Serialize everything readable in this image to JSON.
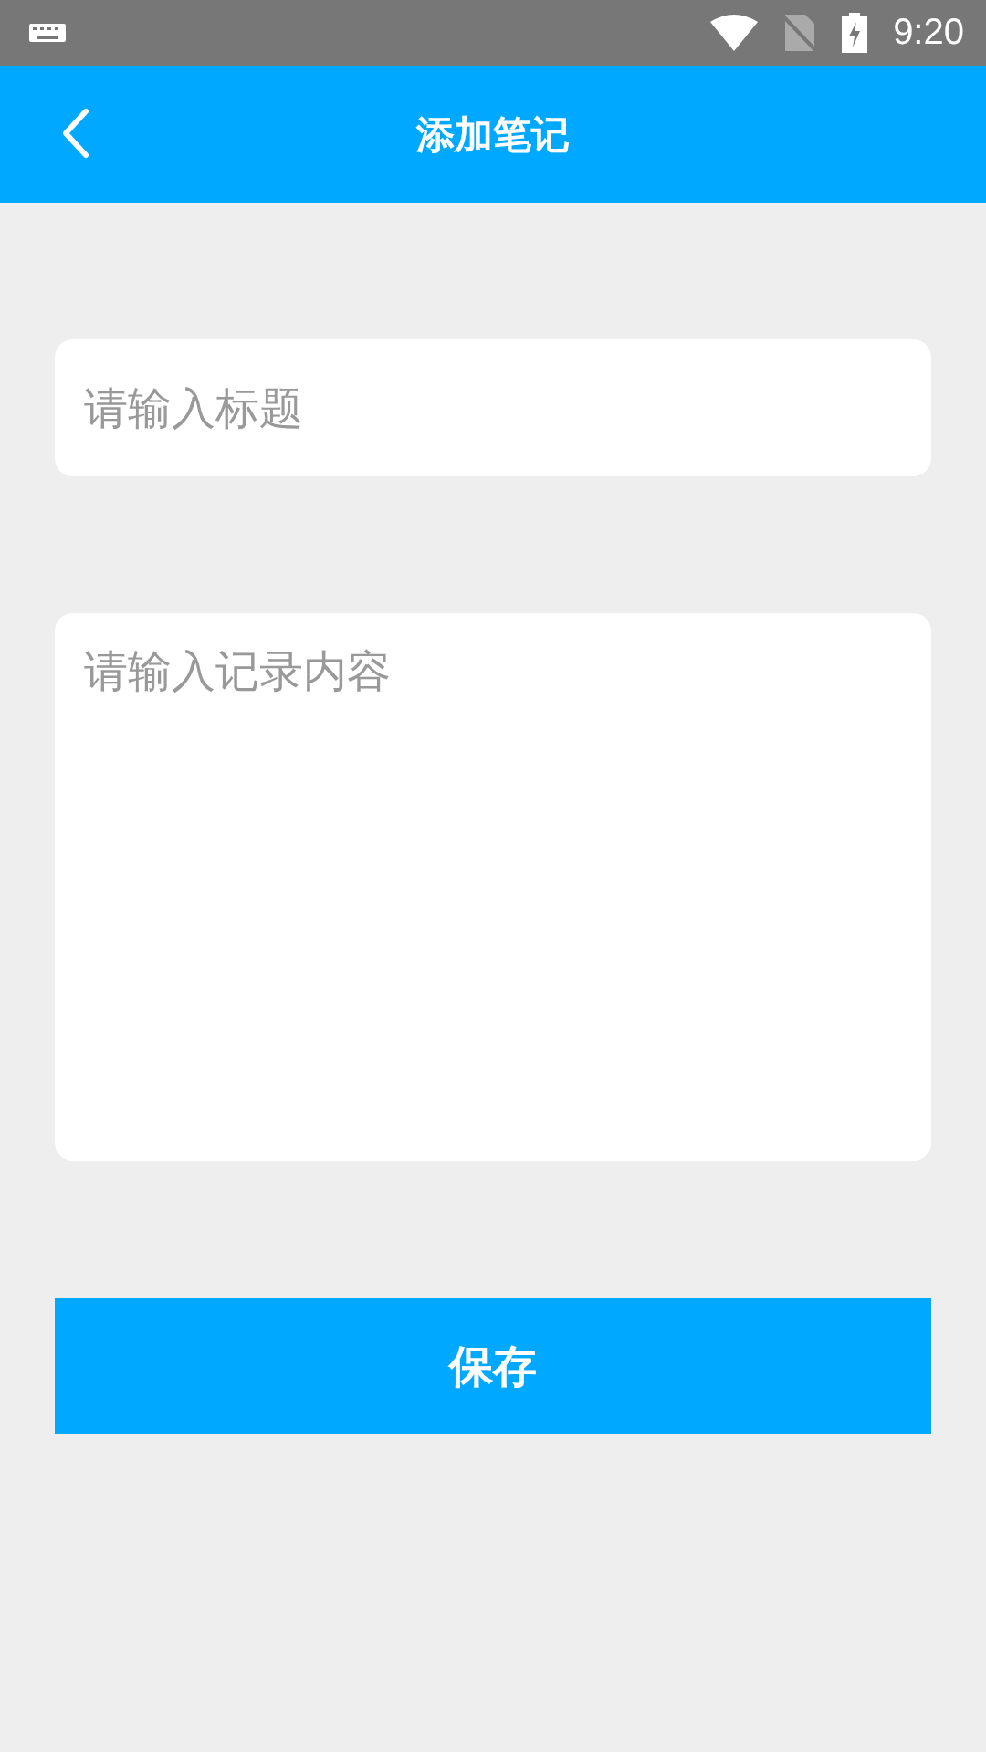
{
  "status_bar": {
    "time": "9:20"
  },
  "header": {
    "title": "添加笔记"
  },
  "title_field": {
    "placeholder": "请输入标题"
  },
  "content_field": {
    "placeholder": "请输入记录内容"
  },
  "save_button": {
    "label": "保存"
  }
}
